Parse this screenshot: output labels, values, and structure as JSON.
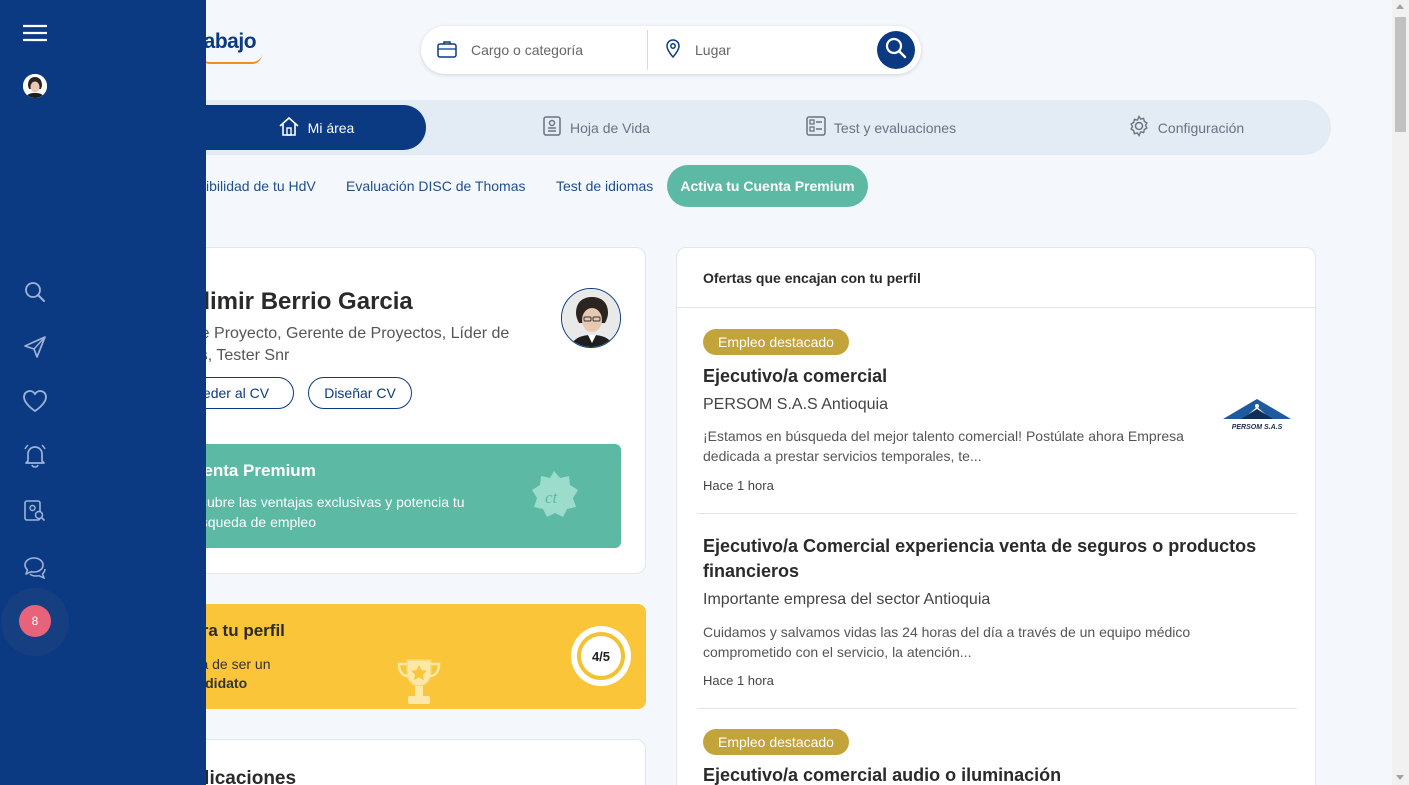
{
  "header": {
    "logo_text": "rabajo",
    "search": {
      "cargo_placeholder": "Cargo o categoría",
      "lugar_placeholder": "Lugar"
    }
  },
  "tabs": [
    {
      "label": "Mi área",
      "icon": "home-icon",
      "active": true
    },
    {
      "label": "Hoja de Vida",
      "icon": "resume-icon"
    },
    {
      "label": "Test y evaluaciones",
      "icon": "checklist-icon"
    },
    {
      "label": "Configuración",
      "icon": "gear-icon"
    }
  ],
  "subnav": [
    {
      "label": "ibilidad de tu HdV"
    },
    {
      "label": "Evaluación DISC de Thomas"
    },
    {
      "label": "Test de idiomas"
    },
    {
      "label": "Activa tu Cuenta Premium",
      "highlight": true
    }
  ],
  "profile": {
    "name": "adimir Berrio Garcia",
    "titles": "r de Proyecto, Gerente de Proyectos, Líder de\nbas, Tester Snr",
    "btn_cv": "ceder al CV",
    "btn_design": "Diseñar CV",
    "premium_title": "uenta Premium",
    "premium_text": "scubre las ventajas exclusivas y potencia tu\núsqueda de empleo"
  },
  "secure": {
    "title": "gura tu perfil",
    "text_line1": "erca de ser un",
    "text_line2": "candidato",
    "progress": "4/5"
  },
  "apps": {
    "title": "aplicaciones"
  },
  "offers": {
    "heading": "Ofertas que encajan con tu perfil",
    "items": [
      {
        "badge": "Empleo destacado",
        "title": "Ejecutivo/a comercial",
        "company": "PERSOM S.A.S Antioquia",
        "desc": "¡Estamos en búsqueda del mejor talento comercial! Postúlate ahora Empresa dedicada a prestar servicios temporales, te...",
        "time": "Hace 1 hora",
        "logo_text": "PERSOM S.A.S"
      },
      {
        "badge": "",
        "title": "Ejecutivo/a Comercial experiencia venta de seguros o productos financieros",
        "company": "Importante empresa del sector Antioquia",
        "desc": "Cuidamos y salvamos vidas las 24 horas del día a través de un equipo médico comprometido con el servicio, la atención...",
        "time": "Hace 1 hora"
      },
      {
        "badge": "Empleo destacado",
        "title": "Ejecutivo/a comercial audio o iluminación"
      }
    ]
  },
  "sidebar": {
    "notification_count": "8",
    "icons": [
      "menu-icon",
      "avatar",
      "search-icon",
      "send-icon",
      "heart-icon",
      "bell-icon",
      "profile-search-icon",
      "chat-icon"
    ]
  },
  "colors": {
    "brand": "#0b3a82",
    "premium": "#5bb9a4",
    "highlight_yellow": "#fbc53a",
    "badge_gold": "#c2a43a",
    "notif": "#e86379"
  }
}
